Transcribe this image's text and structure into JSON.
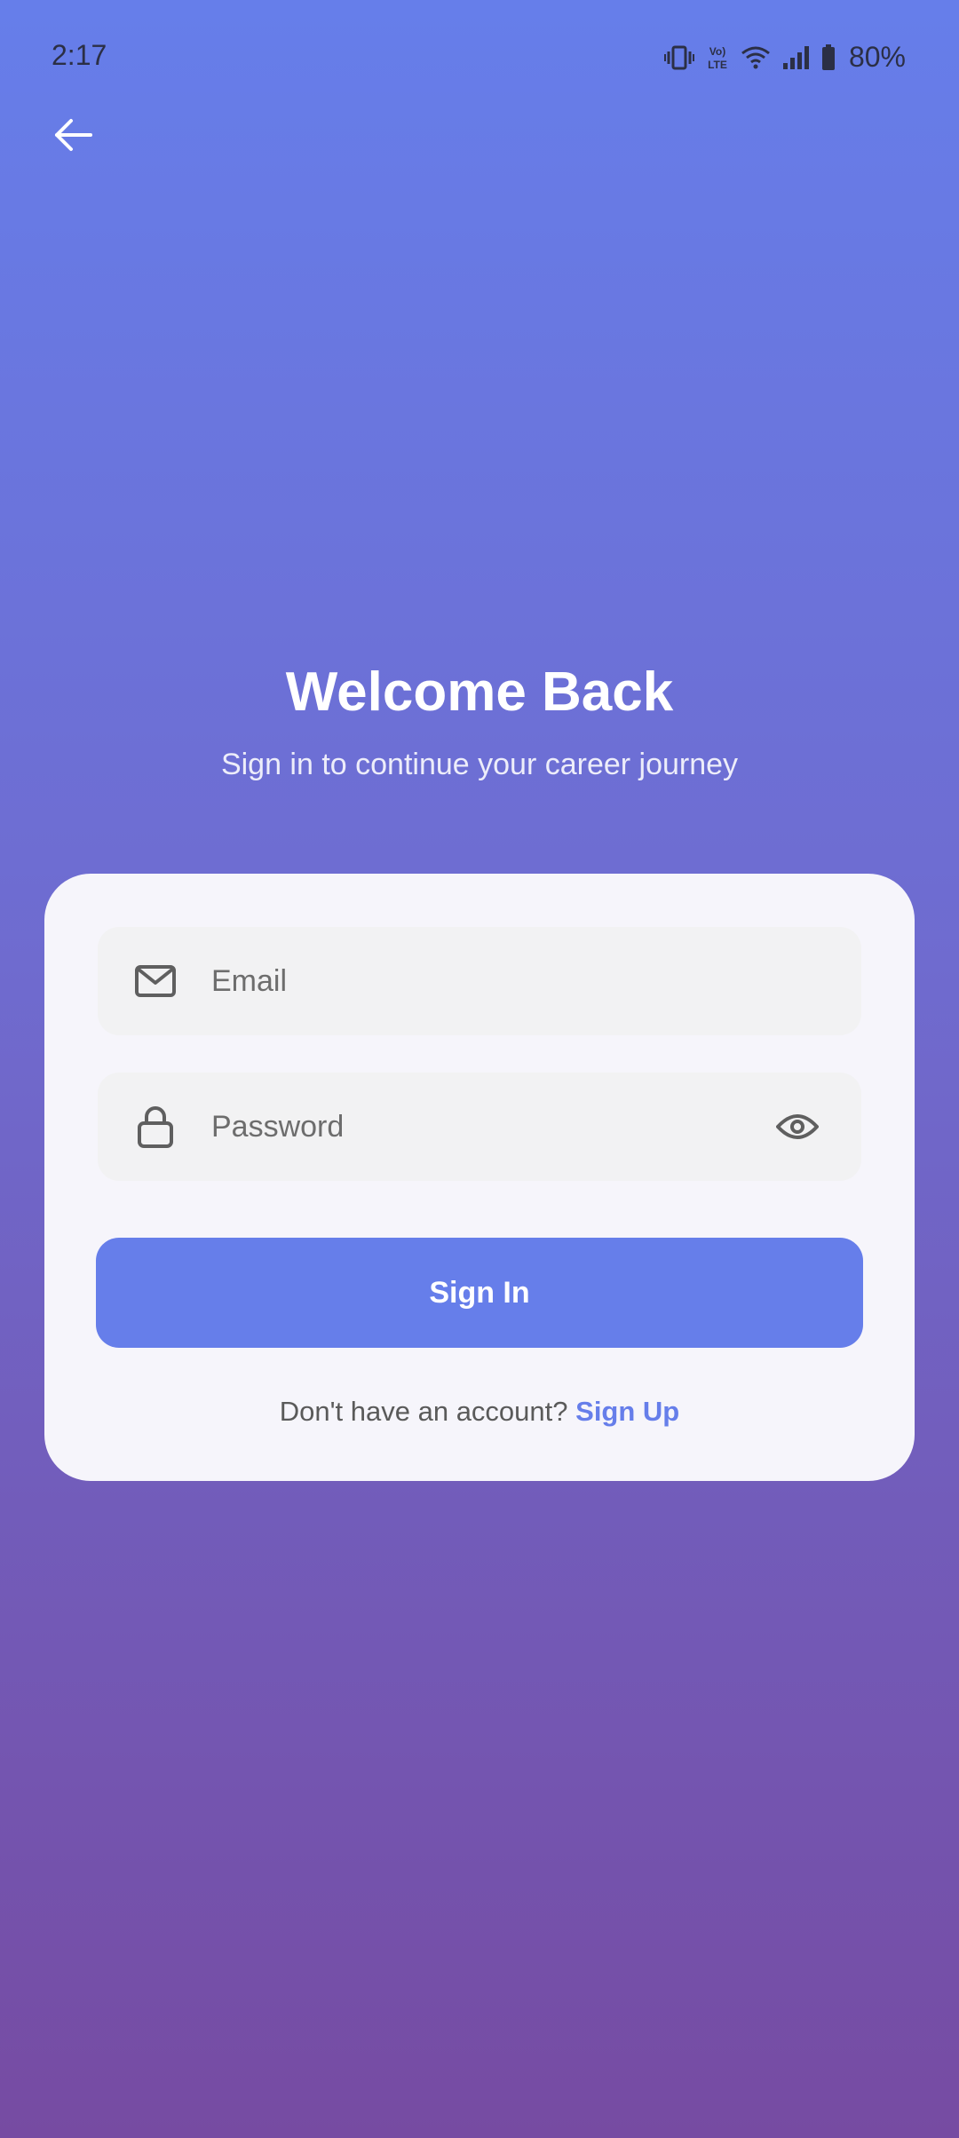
{
  "status_bar": {
    "time": "2:17",
    "icons": [
      "vibrate-icon",
      "volte-icon",
      "wifi-icon",
      "signal-icon",
      "battery-icon"
    ],
    "volte_label": "Vo) LTE",
    "battery": "80%"
  },
  "header": {
    "back_icon": "arrow-left-icon"
  },
  "main": {
    "title": "Welcome Back",
    "subtitle": "Sign in to continue your career journey"
  },
  "form": {
    "email": {
      "icon": "mail-icon",
      "placeholder": "Email",
      "value": ""
    },
    "password": {
      "icon": "lock-icon",
      "placeholder": "Password",
      "value": "",
      "toggle_icon": "eye-icon"
    },
    "submit_label": "Sign In",
    "signup_prompt": "Don't have an account?",
    "signup_link": "Sign Up"
  },
  "colors": {
    "gradient_top": "#667eea",
    "gradient_bottom": "#764ba2",
    "accent": "#667eea",
    "card_bg": "#f6f5fb",
    "field_bg": "#f2f2f3"
  }
}
